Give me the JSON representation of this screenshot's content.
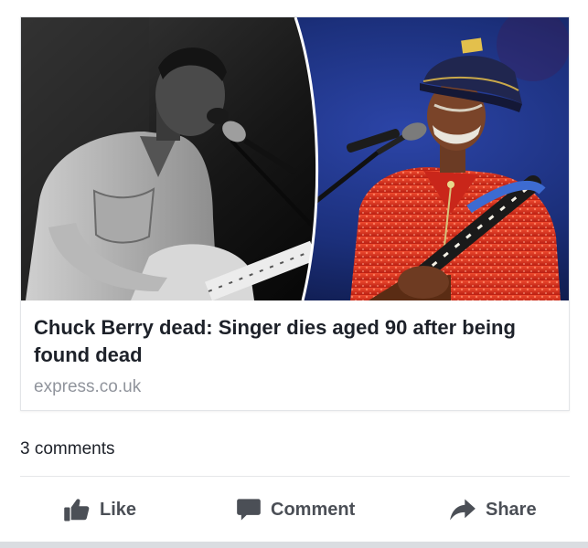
{
  "post": {
    "link": {
      "headline": "Chuck Berry dead: Singer dies aged 90 after being found dead",
      "domain": "express.co.uk",
      "image": {
        "left_subject": "black-and-white photo of guitarist singing into microphone",
        "right_subject": "guitarist in sequined red shirt and captain hat at microphone"
      }
    },
    "comments_count": "3 comments",
    "actions": {
      "like": {
        "label": "Like",
        "icon": "thumbs-up-icon"
      },
      "comment": {
        "label": "Comment",
        "icon": "speech-bubble-icon"
      },
      "share": {
        "label": "Share",
        "icon": "share-arrow-icon"
      }
    }
  },
  "colors": {
    "text_primary": "#1d2129",
    "text_secondary": "#90949c",
    "action_gray": "#4b4f56",
    "shirt_red": "#d9301e",
    "stage_blue": "#1b2f7a"
  }
}
